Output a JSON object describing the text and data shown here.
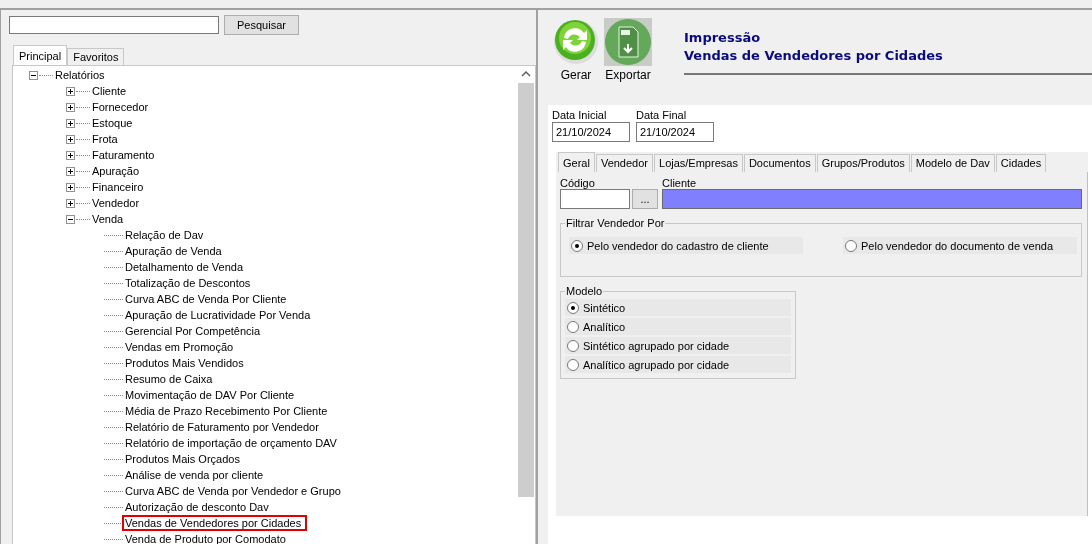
{
  "search": {
    "button": "Pesquisar"
  },
  "left_tabs": [
    {
      "label": "Principal",
      "selected": true
    },
    {
      "label": "Favoritos",
      "selected": false
    }
  ],
  "tree": [
    {
      "label": "Relatórios",
      "expanded": true,
      "selected": false,
      "children": [
        {
          "label": "Cliente",
          "expanded": false,
          "selected": false
        },
        {
          "label": "Fornecedor",
          "expanded": false,
          "selected": false
        },
        {
          "label": "Estoque",
          "expanded": false,
          "selected": false
        },
        {
          "label": "Frota",
          "expanded": false,
          "selected": false
        },
        {
          "label": "Faturamento",
          "expanded": false,
          "selected": false
        },
        {
          "label": "Apuração",
          "expanded": false,
          "selected": false
        },
        {
          "label": "Financeiro",
          "expanded": false,
          "selected": false
        },
        {
          "label": "Vendedor",
          "expanded": false,
          "selected": false
        },
        {
          "label": "Venda",
          "expanded": true,
          "selected": false,
          "children": [
            {
              "label": "Relação de Dav",
              "selected": false
            },
            {
              "label": "Apuração de Venda",
              "selected": false
            },
            {
              "label": "Detalhamento de Venda",
              "selected": false
            },
            {
              "label": "Totalização de Descontos",
              "selected": false
            },
            {
              "label": "Curva ABC de Venda Por Cliente",
              "selected": false
            },
            {
              "label": "Apuração de Lucratividade Por Venda",
              "selected": false
            },
            {
              "label": "Gerencial Por Competência",
              "selected": false
            },
            {
              "label": "Vendas em Promoção",
              "selected": false
            },
            {
              "label": "Produtos Mais Vendidos",
              "selected": false
            },
            {
              "label": "Resumo de Caixa",
              "selected": false
            },
            {
              "label": "Movimentação de DAV Por Cliente",
              "selected": false
            },
            {
              "label": "Média de Prazo Recebimento Por Cliente",
              "selected": false
            },
            {
              "label": "Relatório de Faturamento por Vendedor",
              "selected": false
            },
            {
              "label": "Relatório de importação de orçamento DAV",
              "selected": false
            },
            {
              "label": "Produtos Mais Orçados",
              "selected": false
            },
            {
              "label": "Análise de venda por cliente",
              "selected": false
            },
            {
              "label": "Curva ABC de Venda por Vendedor e Grupo",
              "selected": false
            },
            {
              "label": "Autorização de desconto Dav",
              "selected": false
            },
            {
              "label": "Vendas de Vendedores por Cidades",
              "selected": true
            },
            {
              "label": "Venda de Produto por Comodato",
              "selected": false
            }
          ]
        }
      ]
    }
  ],
  "toolbar": [
    {
      "kind": "refresh",
      "label": "Gerar"
    },
    {
      "kind": "export",
      "label": "Exportar"
    }
  ],
  "header": {
    "subtitle": "Impressão",
    "title": "Vendas de Vendedores por Cidades"
  },
  "dates": [
    {
      "label": "Data Inicial",
      "value": "21/10/2024"
    },
    {
      "label": "Data Final",
      "value": "21/10/2024"
    }
  ],
  "tabs": [
    {
      "label": "Geral",
      "selected": true
    },
    {
      "label": "Vendedor",
      "selected": false
    },
    {
      "label": "Lojas/Empresas",
      "selected": false
    },
    {
      "label": "Documentos",
      "selected": false
    },
    {
      "label": "Grupos/Produtos",
      "selected": false
    },
    {
      "label": "Modelo de Dav",
      "selected": false
    },
    {
      "label": "Cidades",
      "selected": false
    }
  ],
  "codigo": {
    "label": "Código",
    "lookup_button": "..."
  },
  "cliente": {
    "label": "Cliente"
  },
  "filtrar_vendedor": {
    "title": "Filtrar Vendedor Por",
    "options": [
      {
        "label": "Pelo vendedor do cadastro de cliente",
        "selected": true
      },
      {
        "label": "Pelo vendedor do documento de venda",
        "selected": false
      }
    ]
  },
  "modelo": {
    "title": "Modelo",
    "options": [
      {
        "label": "Sintético",
        "selected": true
      },
      {
        "label": "Analítico",
        "selected": false
      },
      {
        "label": "Sintético agrupado por cidade",
        "selected": false
      },
      {
        "label": "Analítico agrupado por cidade",
        "selected": false
      }
    ]
  }
}
